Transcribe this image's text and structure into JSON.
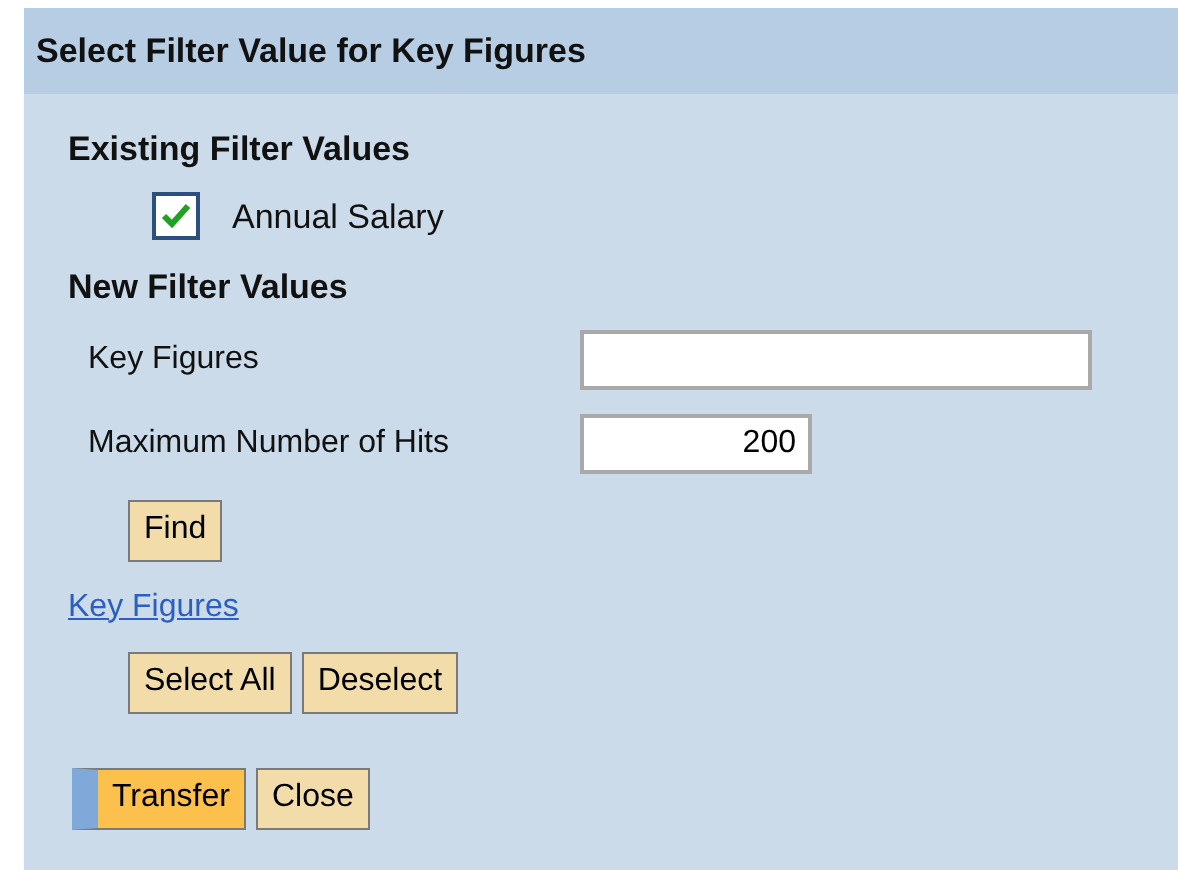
{
  "window": {
    "title": "Select Filter Value for Key Figures"
  },
  "existing": {
    "heading": "Existing Filter Values",
    "items": [
      {
        "label": "Annual Salary",
        "checked": true
      }
    ]
  },
  "new_filter": {
    "heading": "New Filter Values",
    "fields": [
      {
        "label": "Key Figures",
        "kind": "text"
      },
      {
        "label": "Maximum Number of Hits",
        "value": "200",
        "kind": "number"
      }
    ],
    "find_button": "Find"
  },
  "link": "Key Figures",
  "selection_buttons": [
    "Select All",
    "Deselect"
  ],
  "footer_buttons": [
    {
      "label": "Transfer",
      "kind": "primary"
    },
    {
      "label": "Close",
      "kind": "normal"
    }
  ]
}
